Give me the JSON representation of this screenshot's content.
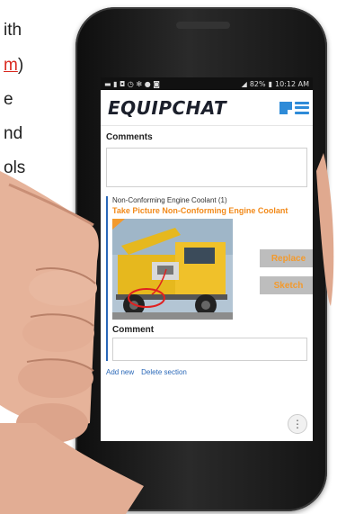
{
  "side_text": [
    "ith",
    "m",
    ")",
    "e",
    "nd",
    "ols"
  ],
  "status_bar": {
    "left_icons": "▬ ▮ ◘ ◷ ✻ ● ◙",
    "battery": "82%",
    "time": "10:12 AM"
  },
  "app": {
    "logo": "EQUIPCHAT"
  },
  "form": {
    "comments_label": "Comments",
    "section_title": "Non-Conforming Engine Coolant (1)",
    "take_picture": "Take Picture Non-Conforming Engine Coolant",
    "replace_label": "Replace",
    "sketch_label": "Sketch",
    "comment_label": "Comment",
    "add_new": "Add new",
    "delete_section": "Delete section",
    "more": "⋮"
  },
  "colors": {
    "accent_blue": "#2e8bd8",
    "orange": "#f28a1a",
    "button_grey": "#bdbdbd"
  }
}
